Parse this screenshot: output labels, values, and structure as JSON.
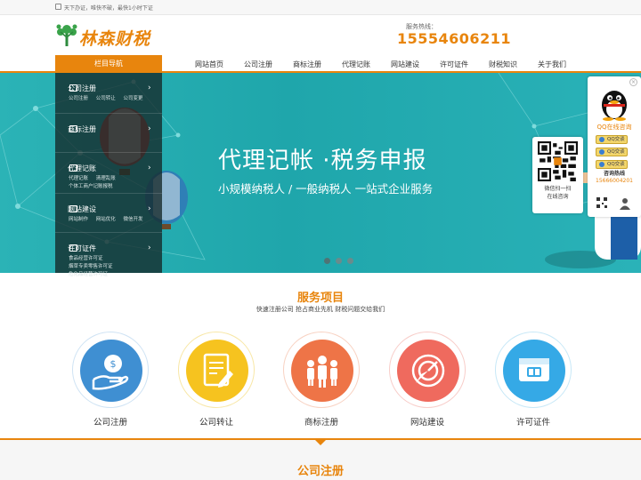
{
  "topbar": {
    "slogan": "天下办证，唯快不破，最快1小时下证"
  },
  "header": {
    "logo_text": "林森财税",
    "hotline_label": "服务热线：",
    "hotline_number": "15554606211"
  },
  "nav": {
    "menu_title": "栏目导航",
    "items": [
      "网站首页",
      "公司注册",
      "商标注册",
      "代理记账",
      "网站建设",
      "许可证件",
      "财税知识",
      "关于我们"
    ]
  },
  "sidebar": {
    "groups": [
      {
        "title": "公司注册",
        "links": [
          "公司注册",
          "公司转让",
          "公司变更"
        ]
      },
      {
        "title": "商标注册",
        "links": []
      },
      {
        "title": "代理记账",
        "links": [
          "代理记账",
          "清理乱账",
          "个体工商户记账报税"
        ]
      },
      {
        "title": "网站建设",
        "links": [
          "网站制作",
          "网站优化",
          "微信开发"
        ]
      },
      {
        "title": "许可证件",
        "links": [
          "食品经营许可证",
          "烟草专卖零售许可证",
          "危化品经营许可证"
        ]
      }
    ]
  },
  "banner": {
    "title": "代理记帐 ·税务申报",
    "subtitle": "小规模纳税人 / 一般纳税人   一站式企业服务",
    "dots": 3,
    "active_dot": 0
  },
  "float_qr": {
    "line1": "微信扫一扫",
    "line2": "在线咨询"
  },
  "float_qq": {
    "close": "×",
    "label": "QQ在线咨询",
    "buttons": [
      "QQ交谈",
      "QQ交谈",
      "QQ交谈"
    ],
    "consult_title": "咨询热线",
    "consult_number": "15666004201"
  },
  "services": {
    "title": "服务项目",
    "subtitle": "快速注册公司 抢占商业先机 财税问题交给我们",
    "items": [
      {
        "label": "公司注册",
        "icon": "money-hand-icon",
        "color": "#3f8fd2"
      },
      {
        "label": "公司转让",
        "icon": "document-edit-icon",
        "color": "#f6c31f"
      },
      {
        "label": "商标注册",
        "icon": "people-group-icon",
        "color": "#ee7447"
      },
      {
        "label": "网站建设",
        "icon": "target-pointer-icon",
        "color": "#ef6a5e"
      },
      {
        "label": "许可证件",
        "icon": "license-card-icon",
        "color": "#35a9e6"
      }
    ]
  },
  "next_section": {
    "title": "公司注册"
  },
  "colors": {
    "brand": "#e8850d",
    "banner": "#1fa6ab"
  }
}
